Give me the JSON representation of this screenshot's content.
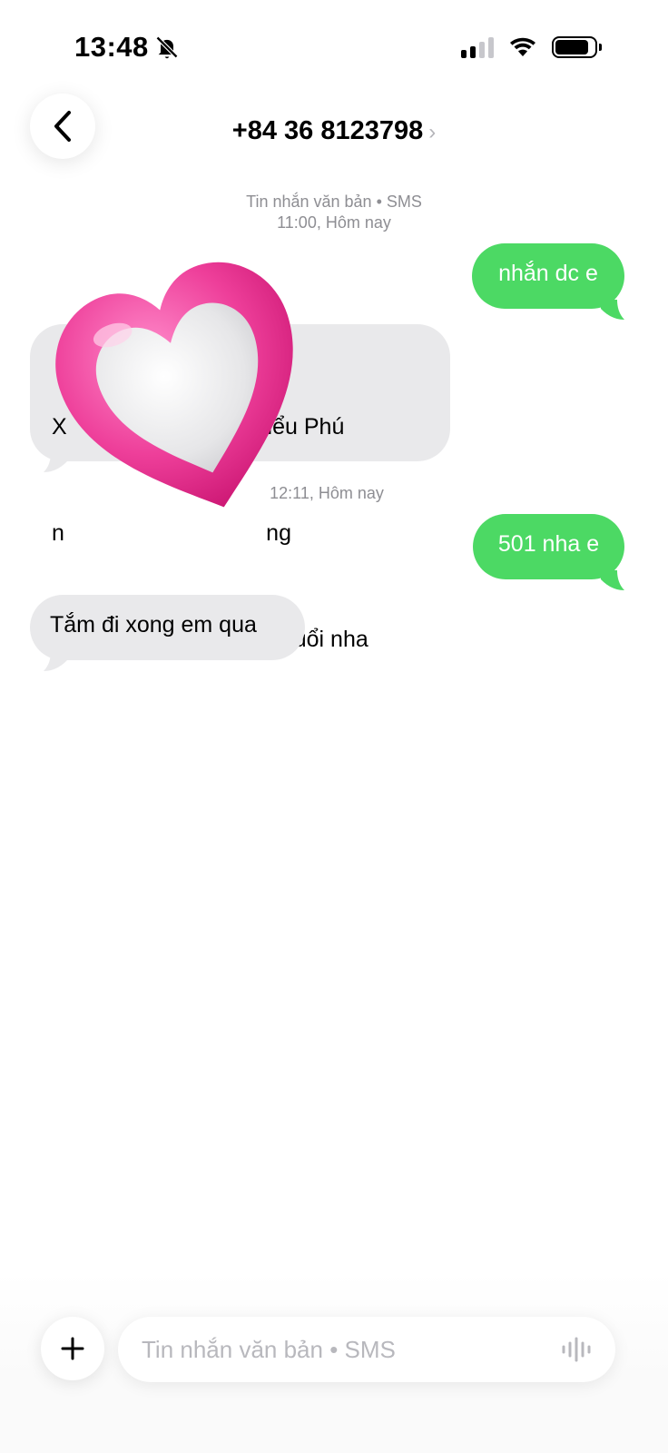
{
  "status_bar": {
    "time": "13:48"
  },
  "header": {
    "contact": "+84 36 8123798",
    "chevron": "›"
  },
  "conversation": {
    "meta_1_line1": "Tin nhắn văn bản • SMS",
    "meta_1_line2": "11:00, Hôm nay",
    "msg_out_1": "nhắn dc e",
    "msg_in_1_line1": "X                           a kiểu Phú",
    "msg_in_1_line2": "n                                ng",
    "msg_in_1_line3": "Em t                      a 50 tuổi nha",
    "meta_2": "12:11, Hôm nay",
    "msg_out_2": "501 nha e",
    "msg_in_2": "Tắm đi xong em qua"
  },
  "composer": {
    "placeholder": "Tin nhắn văn bản • SMS"
  },
  "colors": {
    "outgoing": "#4cd964",
    "incoming": "#e9e9eb",
    "heart": "#e8318c"
  },
  "icons": [
    "bell-slash-icon",
    "signal-icon",
    "wifi-icon",
    "battery-icon",
    "back-chevron-icon",
    "heart-sticker-icon",
    "plus-icon",
    "waveform-icon"
  ]
}
